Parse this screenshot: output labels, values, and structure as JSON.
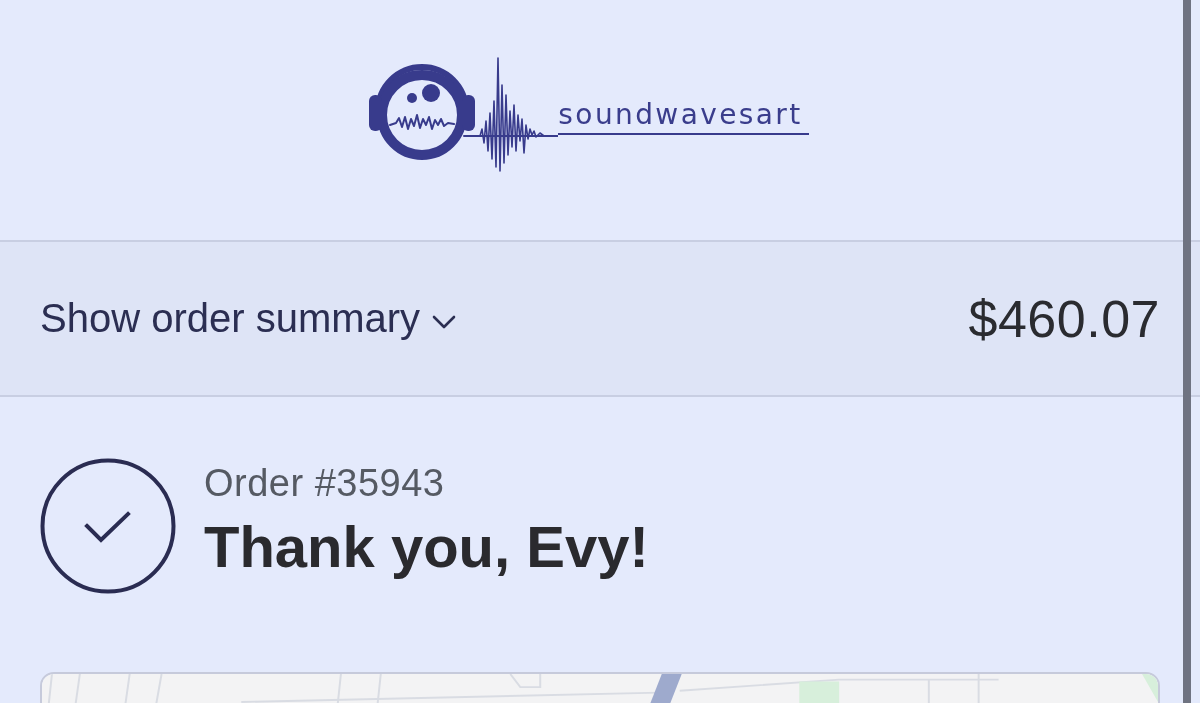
{
  "header": {
    "logo_text": "soundwavesart"
  },
  "summary_bar": {
    "toggle_label": "Show order summary",
    "expanded": false,
    "total": "$460.07"
  },
  "order": {
    "number": "Order #35943",
    "greeting": "Thank you, Evy!"
  }
}
